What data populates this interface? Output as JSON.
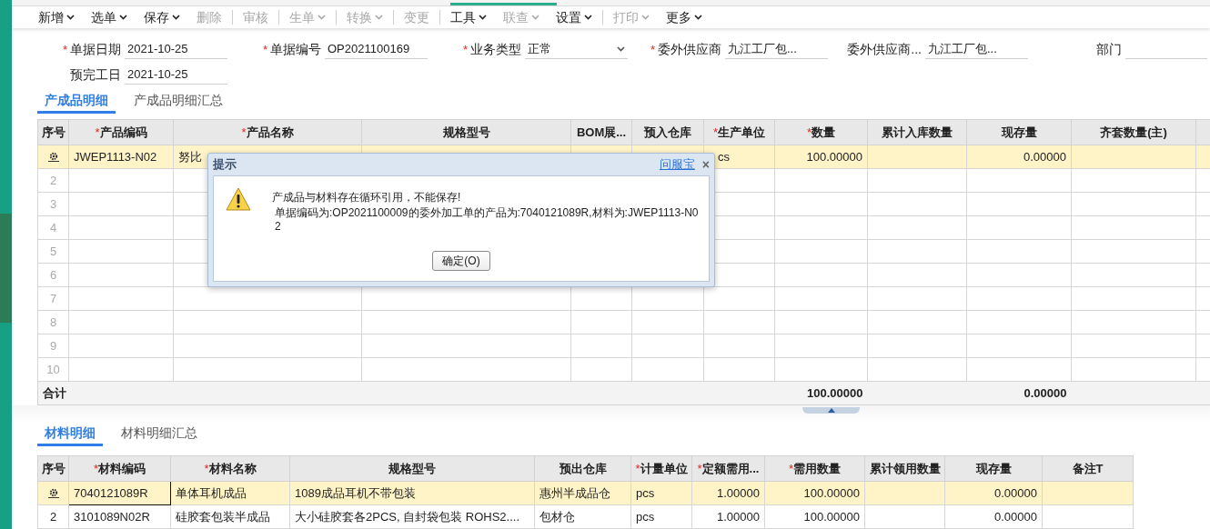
{
  "toolbar": [
    {
      "label": "新增",
      "caret": true,
      "disabled": false,
      "separator_after": false
    },
    {
      "label": "选单",
      "caret": true,
      "disabled": false,
      "separator_after": false
    },
    {
      "label": "保存",
      "caret": true,
      "disabled": false,
      "separator_after": false
    },
    {
      "label": "删除",
      "caret": false,
      "disabled": true,
      "separator_after": true
    },
    {
      "label": "审核",
      "caret": false,
      "disabled": true,
      "separator_after": true
    },
    {
      "label": "生单",
      "caret": true,
      "disabled": true,
      "separator_after": true
    },
    {
      "label": "转换",
      "caret": true,
      "disabled": true,
      "separator_after": true
    },
    {
      "label": "变更",
      "caret": false,
      "disabled": true,
      "separator_after": true
    },
    {
      "label": "工具",
      "caret": true,
      "disabled": false,
      "separator_after": false
    },
    {
      "label": "联查",
      "caret": true,
      "disabled": true,
      "separator_after": false
    },
    {
      "label": "设置",
      "caret": true,
      "disabled": false,
      "separator_after": true
    },
    {
      "label": "打印",
      "caret": true,
      "disabled": true,
      "separator_after": false
    },
    {
      "label": "更多",
      "caret": true,
      "disabled": false,
      "separator_after": false
    }
  ],
  "form": {
    "rows": [
      [
        {
          "mark": "*",
          "label": "单据日期",
          "kind": "text",
          "value": "2021-10-25"
        },
        {
          "mark": "*",
          "label": "单据编号",
          "kind": "text",
          "value": "OP2021100169"
        },
        {
          "mark": "*",
          "label": "业务类型",
          "kind": "select",
          "value": "正常"
        },
        {
          "mark": "*",
          "label": "委外供应商",
          "kind": "text",
          "value": "九江工厂包..."
        },
        {
          "label": "委外供应商...",
          "kind": "text",
          "value": "九江工厂包..."
        },
        {
          "label": "部门",
          "kind": "text"
        }
      ],
      [
        {
          "label": "预完工日",
          "kind": "text",
          "value": "2021-10-25"
        }
      ]
    ]
  },
  "product_tabs": [
    {
      "label": "产成品明细",
      "selected": true
    },
    {
      "label": "产成品明细汇总",
      "selected": false
    }
  ],
  "product_table": {
    "columns": [
      {
        "label": "序号"
      },
      {
        "mark": "*",
        "label": "产品编码"
      },
      {
        "mark": "*",
        "label": "产品名称"
      },
      {
        "label": "规格型号"
      },
      {
        "label": "BOM展..."
      },
      {
        "label": "预入仓库"
      },
      {
        "mark": "*",
        "label": "生产单位"
      },
      {
        "mark": "*",
        "label": "数量"
      },
      {
        "label": "累计入库数量"
      },
      {
        "label": "现存量"
      },
      {
        "label": "齐套数量(主)"
      }
    ],
    "rows": [
      {
        "selected": true,
        "cells": [
          null,
          "JWEP1113-N02",
          "努比",
          null,
          null,
          null,
          "cs",
          "100.00000",
          null,
          "0.00000",
          null
        ]
      },
      {
        "selected": false,
        "cells": [
          "2"
        ]
      },
      {
        "selected": false,
        "cells": [
          "3"
        ]
      },
      {
        "selected": false,
        "cells": [
          "4"
        ]
      },
      {
        "selected": false,
        "cells": [
          "5"
        ]
      },
      {
        "selected": false,
        "cells": [
          "6"
        ]
      },
      {
        "selected": false,
        "cells": [
          "7"
        ]
      },
      {
        "selected": false,
        "cells": [
          "8"
        ]
      },
      {
        "selected": false,
        "cells": [
          "9"
        ]
      },
      {
        "selected": false,
        "cells": [
          "10"
        ]
      }
    ],
    "total": {
      "cells": [
        "合计",
        null,
        null,
        null,
        null,
        null,
        null,
        "100.00000",
        null,
        "0.00000",
        null
      ]
    }
  },
  "material_tabs": [
    {
      "label": "材料明细",
      "selected": true
    },
    {
      "label": "材料明细汇总",
      "selected": false
    }
  ],
  "material_table": {
    "columns": [
      {
        "label": "序号"
      },
      {
        "mark": "*",
        "label": "材料编码"
      },
      {
        "mark": "*",
        "label": "材料名称"
      },
      {
        "label": "规格型号"
      },
      {
        "label": "预出仓库"
      },
      {
        "mark": "*",
        "label": "计量单位"
      },
      {
        "mark": "*",
        "label": "定额需用..."
      },
      {
        "mark": "*",
        "label": "需用数量"
      },
      {
        "label": "累计领用数量"
      },
      {
        "label": "现存量"
      },
      {
        "label": "备注T"
      }
    ],
    "rows": [
      {
        "selected": true,
        "cells": [
          null,
          "7040121089R",
          "单体耳机成品",
          "1089成品耳机不带包装",
          "惠州半成品仓",
          "pcs",
          "1.00000",
          "100.00000",
          null,
          "0.00000",
          null
        ]
      },
      {
        "selected": false,
        "cells": [
          "2",
          "3101089N02R",
          "硅胶套包装半成品",
          "大小硅胶套各2PCS, 自封袋包装 ROHS2....",
          "包材仓",
          "pcs",
          "1.00000",
          "100.00000",
          null,
          "0.00000",
          null
        ]
      }
    ]
  },
  "dialog": {
    "title": "提示",
    "link": "问服宝",
    "close": "×",
    "message": "产成品与材料存在循环引用，不能保存!",
    "detail": "单据编码为:OP2021100009的委外加工单的产品为:7040121089R,材料为:JWEP1113-N02",
    "button": "确定(O)"
  }
}
